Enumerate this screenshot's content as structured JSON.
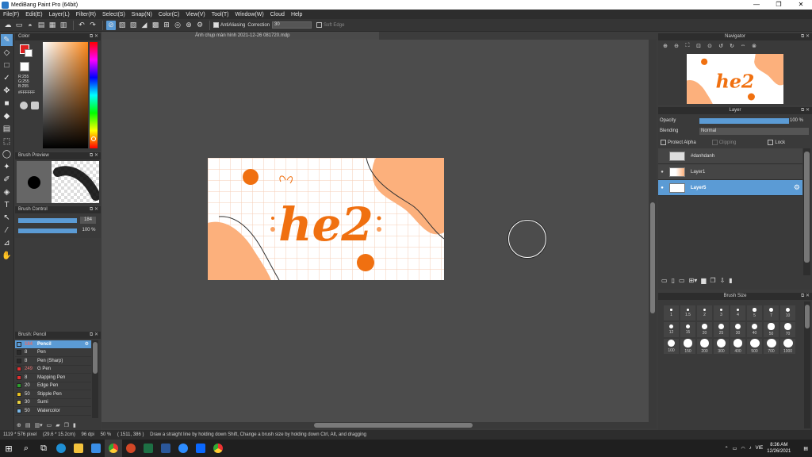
{
  "window": {
    "title": "MediBang Paint Pro (64bit)",
    "minimize": "—",
    "maximize": "❐",
    "close": "✕"
  },
  "menu": [
    "File(F)",
    "Edit(E)",
    "Layer(L)",
    "Filter(R)",
    "Select(S)",
    "Snap(N)",
    "Color(C)",
    "View(V)",
    "Tool(T)",
    "Window(W)",
    "Cloud",
    "Help"
  ],
  "toolbar": {
    "antialiasing_label": "AntiAliasing",
    "correction_label": "Correction",
    "correction_value": "30",
    "soft_edge_label": "Soft Edge"
  },
  "color_panel": {
    "title": "Color",
    "r": "R:255",
    "g": "G:255",
    "b": "B:255",
    "hex": "#FFFFFF",
    "primary_color": "#e02020",
    "secondary_color": "#ffffff"
  },
  "brush_preview": {
    "title": "Brush Preview"
  },
  "brush_control": {
    "title": "Brush Control",
    "size": "184",
    "opacity": "100 %"
  },
  "brush_list": {
    "title": "Brush: Pencil",
    "items": [
      {
        "size": "184",
        "name": "Pencil",
        "color": "#5b9bd5",
        "selected": true
      },
      {
        "size": "8",
        "name": "Pen",
        "color": "#2a2a2a"
      },
      {
        "size": "8",
        "name": "Pen (Sharp)",
        "color": "#2a2a2a"
      },
      {
        "size": "249",
        "name": "G Pen",
        "color": "#e03030"
      },
      {
        "size": "8",
        "name": "Mapping Pen",
        "color": "#e03030"
      },
      {
        "size": "20",
        "name": "Edge Pen",
        "color": "#2ca02c"
      },
      {
        "size": "50",
        "name": "Stipple Pen",
        "color": "#e8c020"
      },
      {
        "size": "30",
        "name": "Sumi",
        "color": "#e8d040"
      },
      {
        "size": "50",
        "name": "Watercolor",
        "color": "#7ab8e8"
      }
    ]
  },
  "document": {
    "tab_title": "Ảnh chụp màn hình 2021-12-26 081720.mdp",
    "art_text": "he2",
    "colors": {
      "orange": "#f07010",
      "peach": "#fcb07c",
      "grid": "#f5cdb4"
    }
  },
  "navigator": {
    "title": "Navigator",
    "art_text": "he2"
  },
  "layer_panel": {
    "title": "Layer",
    "opacity_label": "Opacity",
    "opacity_value": "100 %",
    "opacity_fraction": 1.0,
    "blending_label": "Blending",
    "blending_value": "Normal",
    "protect_alpha": "Protect Alpha",
    "clipping": "Clipping",
    "lock": "Lock",
    "layers": [
      {
        "name": "#danhdanh",
        "visible": false,
        "selected": false
      },
      {
        "name": "Layer1",
        "visible": true,
        "selected": false
      },
      {
        "name": "Layer5",
        "visible": true,
        "selected": true
      }
    ]
  },
  "brush_size": {
    "title": "Brush Size",
    "sizes": [
      "1",
      "1.5",
      "2",
      "3",
      "4",
      "5",
      "7",
      "10",
      "12",
      "15",
      "20",
      "25",
      "30",
      "40",
      "50",
      "70",
      "100",
      "150",
      "200",
      "300",
      "400",
      "500",
      "700",
      "1000"
    ]
  },
  "status": {
    "dimensions": "1119 * 576 pixel",
    "physical": "(29.6 * 15.2cm)",
    "dpi": "96 dpi",
    "zoom": "50 %",
    "coords": "( 1511, 386 )",
    "hint": "Draw a straight line by holding down Shift, Change a brush size by holding down Ctrl, Alt, and dragging"
  },
  "taskbar": {
    "language": "VIE",
    "time": "8:36 AM",
    "date": "12/26/2021"
  }
}
